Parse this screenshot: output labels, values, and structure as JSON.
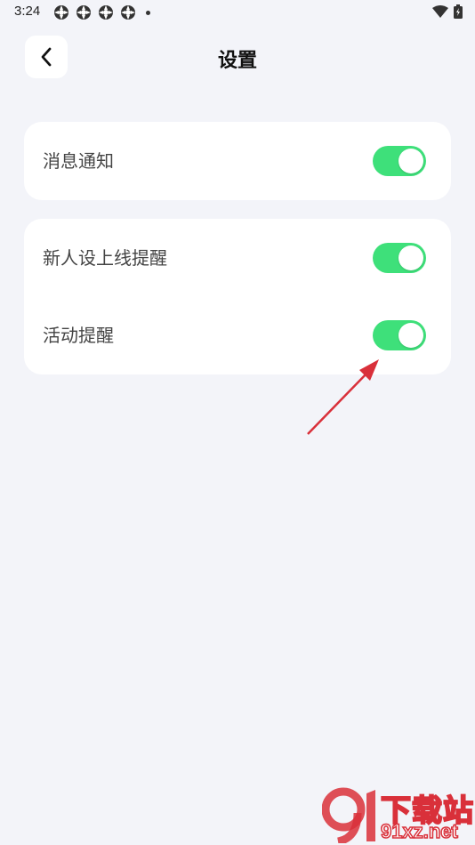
{
  "status_bar": {
    "time": "3:24"
  },
  "header": {
    "title": "设置"
  },
  "settings": {
    "notifications": {
      "label": "消息通知",
      "enabled": true
    },
    "group2": [
      {
        "label": "新人设上线提醒",
        "enabled": true
      },
      {
        "label": "活动提醒",
        "enabled": true
      }
    ]
  },
  "colors": {
    "toggle_on": "#3ee07a",
    "background": "#f3f4f9",
    "annotation_arrow": "#d9303a"
  },
  "watermark": {
    "line1": "下载站",
    "line2": "91xz.net"
  }
}
